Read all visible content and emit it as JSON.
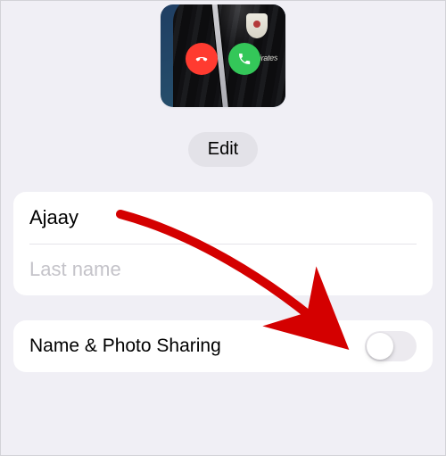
{
  "preview": {
    "decline_icon": "phone-down-icon",
    "accept_icon": "phone-icon",
    "shirt_text": "Emirates"
  },
  "edit": {
    "label": "Edit"
  },
  "name_section": {
    "first_name_value": "Ajaay",
    "last_name_value": "",
    "last_name_placeholder": "Last name"
  },
  "sharing_section": {
    "label": "Name & Photo Sharing",
    "toggle_on": false
  },
  "annotation": {
    "arrow_color": "#d40000"
  }
}
